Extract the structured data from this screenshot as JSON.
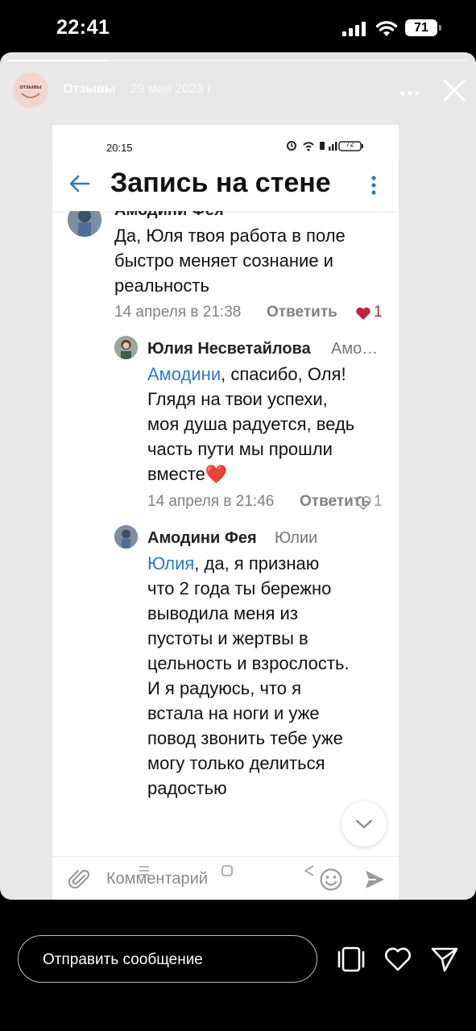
{
  "status_bar": {
    "time": "22:41",
    "battery": "71"
  },
  "story": {
    "account_name": "Отзывы",
    "avatar_text": "отзывы",
    "date": "29 мая 2023 г.",
    "progress": 0.22
  },
  "screenshot": {
    "status_time": "20:15",
    "battery": "72",
    "page_title": "Запись на стене",
    "comments": [
      {
        "author": "Амодини Фея",
        "lines": [
          "Да, Юля твоя работа в поле",
          "быстро меняет сознание и",
          "реальность"
        ],
        "date": "14 апреля в 21:38",
        "reply_label": "Ответить",
        "likes": "1"
      },
      {
        "author": "Юлия Несветайлова",
        "reply_to": "Амо…",
        "mention": "Амодини",
        "first_line_rest": ", спасибо, Оля!",
        "lines": [
          "Глядя на твои успехи,",
          "моя душа радуется, ведь",
          "часть пути мы прошли",
          "вместе❤️"
        ],
        "date": "14 апреля в 21:46",
        "reply_label": "Ответить",
        "likes": "1"
      },
      {
        "author": "Амодини Фея",
        "reply_to": "Юлии",
        "mention": "Юлия",
        "first_line_rest": ", да, я признаю",
        "lines": [
          "что 2 года ты бережно",
          "выводила меня из",
          "пустоты и жертвы  в",
          "цельность и взрослость.",
          "И я радуюсь, что я",
          "встала на ноги и уже",
          "повод звонить тебе уже",
          "могу только делиться",
          "радостью"
        ]
      }
    ],
    "composer_placeholder": "Комментарий"
  },
  "footer": {
    "message_placeholder": "Отправить сообщение"
  },
  "colors": {
    "link": "#2a7bd0",
    "like": "#c21f3d",
    "back_arrow": "#2a7bd0"
  }
}
